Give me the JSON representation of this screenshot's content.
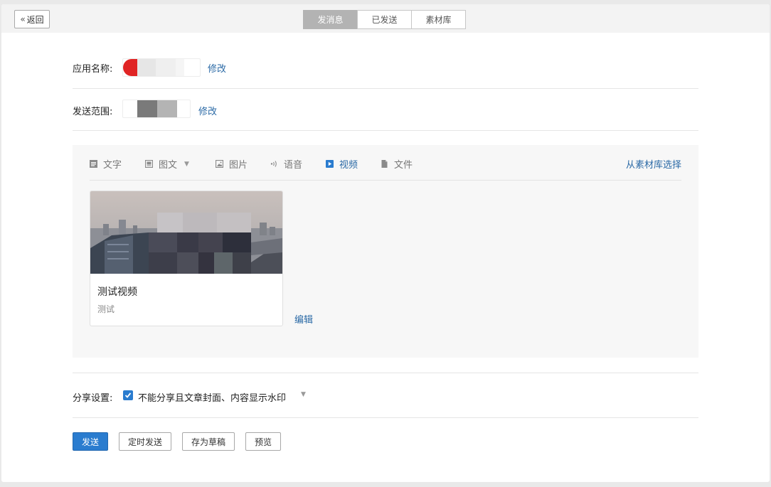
{
  "header": {
    "back_label": "返回",
    "tabs": [
      {
        "label": "发消息",
        "active": true
      },
      {
        "label": "已发送",
        "active": false
      },
      {
        "label": "素材库",
        "active": false
      }
    ]
  },
  "app_name": {
    "label": "应用名称:",
    "edit_label": "修改"
  },
  "scope": {
    "label": "发送范围:",
    "edit_label": "修改"
  },
  "editor": {
    "tools": [
      {
        "label": "文字",
        "icon": "text-icon"
      },
      {
        "label": "图文",
        "icon": "news-icon",
        "has_dropdown": true
      },
      {
        "label": "图片",
        "icon": "image-icon"
      },
      {
        "label": "语音",
        "icon": "voice-icon"
      },
      {
        "label": "视频",
        "icon": "video-icon",
        "active": true
      },
      {
        "label": "文件",
        "icon": "file-icon"
      }
    ],
    "library_link": "从素材库选择",
    "video": {
      "title": "测试视频",
      "description": "测试"
    },
    "edit_label": "编辑"
  },
  "share": {
    "label": "分享设置:",
    "option_label": "不能分享且文章封面、内容显示水印",
    "checked": true
  },
  "actions": {
    "send": "发送",
    "schedule": "定时发送",
    "save_draft": "存为草稿",
    "preview": "预览"
  },
  "colors": {
    "accent": "#2a7ccf",
    "link": "#2b6aa6",
    "active_tab": "#b3b3b3"
  }
}
